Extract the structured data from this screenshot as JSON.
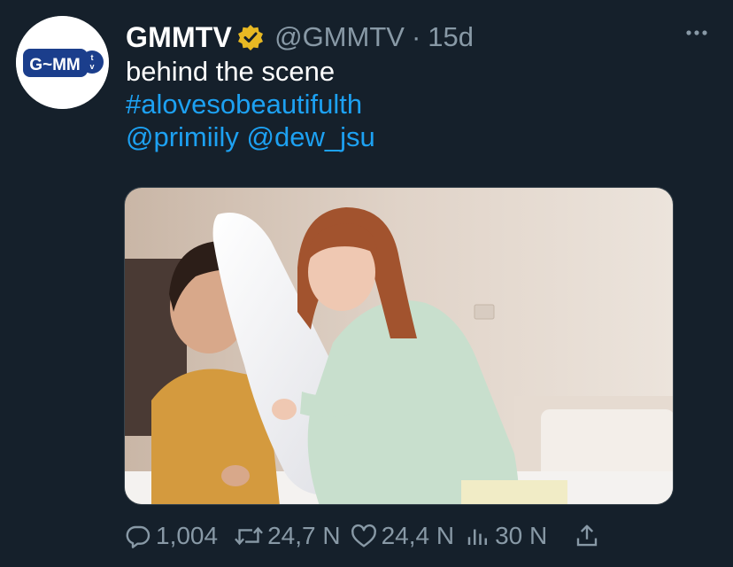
{
  "account": {
    "avatar_logo": "G~MM tv",
    "display_name": "GMMTV",
    "verified_icon": "verified-badge-icon",
    "handle": "@GMMTV",
    "separator": "·",
    "timestamp": "15d"
  },
  "tweet": {
    "text_line": "behind the scene",
    "hashtag": "#alovesobeautifulth",
    "mention_1": "@primiily",
    "mention_2": "@dew_jsu"
  },
  "actions": {
    "reply_count": "1,004",
    "retweet_count": "24,7 N",
    "like_count": "24,4 N",
    "views_count": "30 N"
  },
  "colors": {
    "background": "#15202b",
    "link": "#1da1f2",
    "secondary": "#8899a6",
    "verified": "#e8b923"
  }
}
